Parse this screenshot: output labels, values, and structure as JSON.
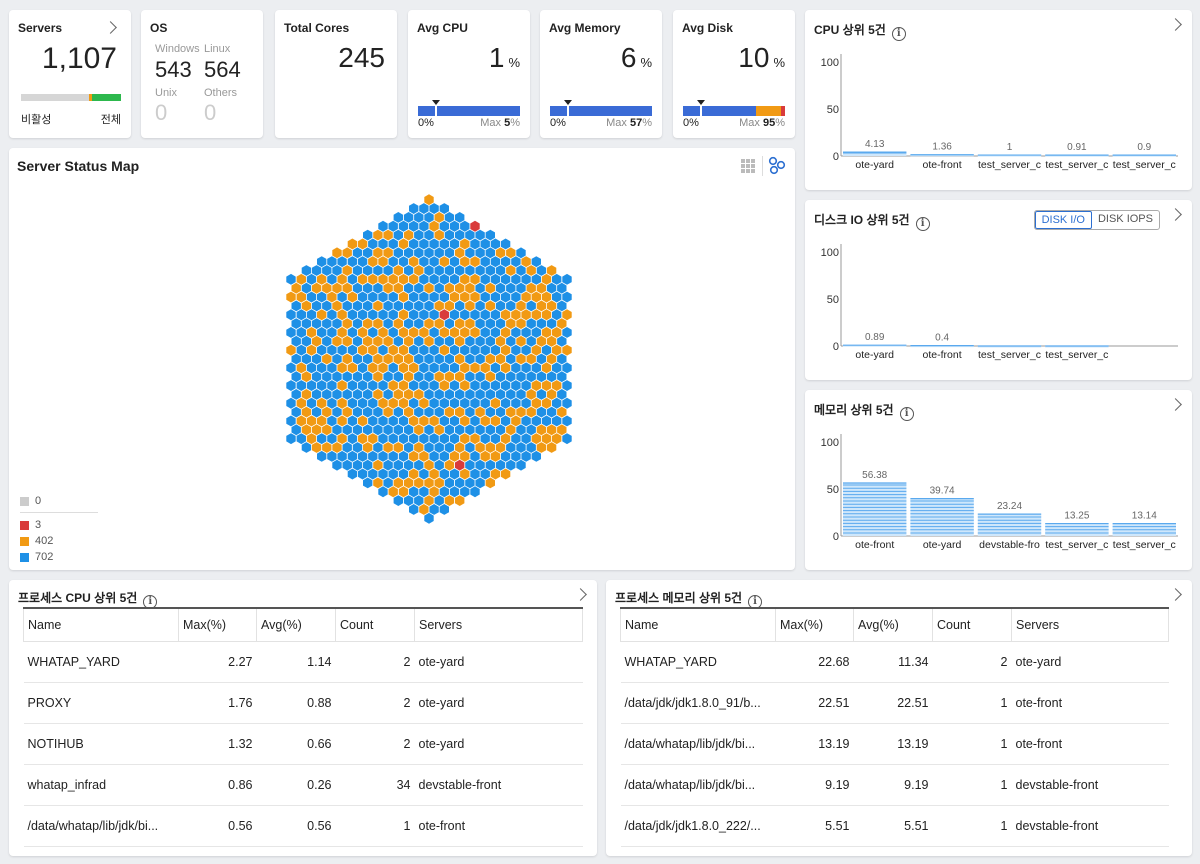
{
  "colors": {
    "accent": "#3a6bd6",
    "blue": "#1e90e6",
    "orange": "#f19a14",
    "red": "#d93b3b",
    "gray": "#cccccc",
    "green": "#2db84d"
  },
  "servers": {
    "title": "Servers",
    "count": "1,107",
    "left_label": "비활성",
    "right_label": "전체"
  },
  "os": {
    "title": "OS",
    "windows_label": "Windows",
    "linux_label": "Linux",
    "windows_value": "543",
    "linux_value": "564",
    "unix_label": "Unix",
    "others_label": "Others",
    "unix_value": "0",
    "others_value": "0"
  },
  "cores": {
    "title": "Total Cores",
    "value": "245"
  },
  "avg_cpu": {
    "title": "Avg CPU",
    "value": "1",
    "unit": "%",
    "min": "0%",
    "max_label": "Max",
    "max_value": "5",
    "max_unit": "%",
    "avg_fraction": 0.01,
    "max_fraction": 0.05
  },
  "avg_mem": {
    "title": "Avg Memory",
    "value": "6",
    "unit": "%",
    "min": "0%",
    "max_label": "Max",
    "max_value": "57",
    "max_unit": "%",
    "avg_fraction": 0.06,
    "max_fraction": 0.57
  },
  "avg_disk": {
    "title": "Avg Disk",
    "value": "10",
    "unit": "%",
    "min": "0%",
    "max_label": "Max",
    "max_value": "95",
    "max_unit": "%",
    "avg_fraction": 0.1,
    "max_fraction": 0.95
  },
  "status_map": {
    "title": "Server Status Map",
    "legend": [
      {
        "label": "0",
        "color": "#cccccc"
      },
      {
        "label": "3",
        "color": "#d93b3b"
      },
      {
        "label": "402",
        "color": "#f19a14"
      },
      {
        "label": "702",
        "color": "#1e90e6"
      }
    ]
  },
  "chart_data": [
    {
      "type": "bar",
      "title": "CPU 상위 5건",
      "categories": [
        "ote-yard",
        "ote-front",
        "test_server_c",
        "test_server_c",
        "test_server_c"
      ],
      "values": [
        4.13,
        1.36,
        1,
        0.91,
        0.9
      ],
      "value_labels": [
        "4.13",
        "1.36",
        "1",
        "0.91",
        "0.9"
      ],
      "ylim": [
        0,
        100
      ],
      "yticks": [
        "100",
        "50",
        "0"
      ]
    },
    {
      "type": "bar",
      "title": "디스크 IO 상위 5건",
      "categories": [
        "ote-yard",
        "ote-front",
        "test_server_c",
        "test_server_c"
      ],
      "values": [
        0.89,
        0.4,
        0,
        0
      ],
      "value_labels": [
        "0.89",
        "0.4",
        "",
        ""
      ],
      "ylim": [
        0,
        100
      ],
      "yticks": [
        "100",
        "50",
        "0"
      ]
    },
    {
      "type": "bar",
      "title": "메모리 상위 5건",
      "categories": [
        "ote-front",
        "ote-yard",
        "devstable-fro",
        "test_server_c",
        "test_server_c"
      ],
      "values": [
        56.38,
        39.74,
        23.24,
        13.25,
        13.14
      ],
      "value_labels": [
        "56.38",
        "39.74",
        "23.24",
        "13.25",
        "13.14"
      ],
      "ylim": [
        0,
        100
      ],
      "yticks": [
        "100",
        "50",
        "0"
      ]
    }
  ],
  "disk_toggle": {
    "io": "DISK I/O",
    "iops": "DISK IOPS"
  },
  "proc_cpu": {
    "title": "프로세스 CPU 상위 5건",
    "headers": [
      "Name",
      "Max(%)",
      "Avg(%)",
      "Count",
      "Servers"
    ],
    "rows": [
      [
        "WHATAP_YARD",
        "2.27",
        "1.14",
        "2",
        "ote-yard"
      ],
      [
        "PROXY",
        "1.76",
        "0.88",
        "2",
        "ote-yard"
      ],
      [
        "NOTIHUB",
        "1.32",
        "0.66",
        "2",
        "ote-yard"
      ],
      [
        "whatap_infrad",
        "0.86",
        "0.26",
        "34",
        "devstable-front"
      ],
      [
        "/data/whatap/lib/jdk/bi...",
        "0.56",
        "0.56",
        "1",
        "ote-front"
      ]
    ]
  },
  "proc_mem": {
    "title": "프로세스 메모리 상위 5건",
    "headers": [
      "Name",
      "Max(%)",
      "Avg(%)",
      "Count",
      "Servers"
    ],
    "rows": [
      [
        "WHATAP_YARD",
        "22.68",
        "11.34",
        "2",
        "ote-yard"
      ],
      [
        "/data/jdk/jdk1.8.0_91/b...",
        "22.51",
        "22.51",
        "1",
        "ote-front"
      ],
      [
        "/data/whatap/lib/jdk/bi...",
        "13.19",
        "13.19",
        "1",
        "ote-front"
      ],
      [
        "/data/whatap/lib/jdk/bi...",
        "9.19",
        "9.19",
        "1",
        "devstable-front"
      ],
      [
        "/data/jdk/jdk1.8.0_222/...",
        "5.51",
        "5.51",
        "1",
        "devstable-front"
      ]
    ]
  }
}
